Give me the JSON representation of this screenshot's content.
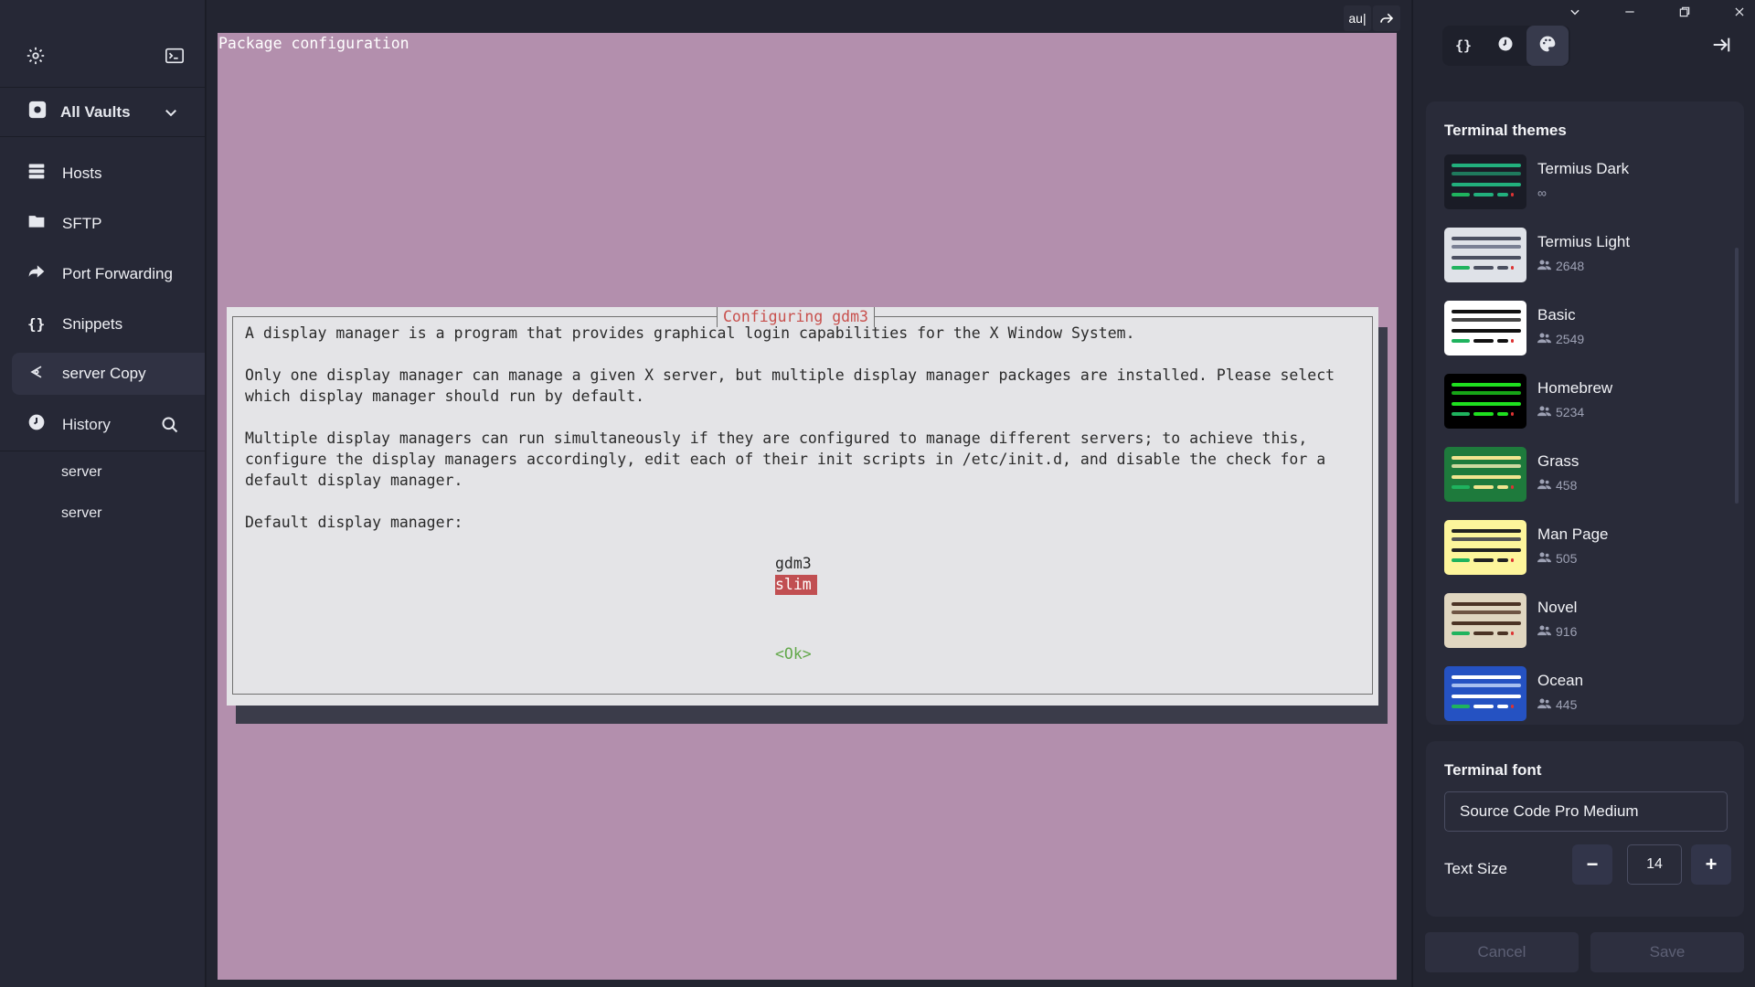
{
  "sidebar": {
    "vault_label": "All Vaults",
    "nav": [
      {
        "label": "Hosts"
      },
      {
        "label": "SFTP"
      },
      {
        "label": "Port Forwarding"
      },
      {
        "label": "Snippets"
      }
    ],
    "active_session": "server Copy",
    "history_label": "History",
    "history_items": [
      "server",
      "server"
    ]
  },
  "terminal": {
    "title": "Package configuration",
    "tool_text": "au|",
    "dialog": {
      "title": "Configuring gdm3",
      "line1": "A display manager is a program that provides graphical login capabilities for the X Window System.",
      "line2": "Only one display manager can manage a given X server, but multiple display manager packages are installed. Please select",
      "line3": "which display manager should run by default.",
      "line4": "Multiple display managers can run simultaneously if they are configured to manage different servers; to achieve this,",
      "line5": "configure the display managers accordingly, edit each of their init scripts in /etc/init.d, and disable the check for a",
      "line6": "default display manager.",
      "line7": "Default display manager:",
      "options": [
        "gdm3",
        "slim"
      ],
      "selected": "slim",
      "ok": "<Ok>"
    }
  },
  "panel": {
    "themes_title": "Terminal themes",
    "themes": [
      {
        "name": "Termius Dark",
        "count": "∞",
        "bg": "#1a1c26",
        "bar": "#22b07d",
        "bar2": "#1f7a5d"
      },
      {
        "name": "Termius Light",
        "count": "2648",
        "bg": "#dfe2e8",
        "bar": "#4a4f60",
        "bar2": "#7a8094"
      },
      {
        "name": "Basic",
        "count": "2549",
        "bg": "#ffffff",
        "bar": "#111111",
        "bar2": "#444444"
      },
      {
        "name": "Homebrew",
        "count": "5234",
        "bg": "#000000",
        "bar": "#1fe01f",
        "bar2": "#17a517"
      },
      {
        "name": "Grass",
        "count": "458",
        "bg": "#1e7a3c",
        "bar": "#f1e58f",
        "bar2": "#cfd9a0"
      },
      {
        "name": "Man Page",
        "count": "505",
        "bg": "#fdf59b",
        "bar": "#222222",
        "bar2": "#555555"
      },
      {
        "name": "Novel",
        "count": "916",
        "bg": "#e0d6c0",
        "bar": "#4b3325",
        "bar2": "#6e5443"
      },
      {
        "name": "Ocean",
        "count": "445",
        "bg": "#2552c2",
        "bar": "#ffffff",
        "bar2": "#a8c0f0"
      }
    ],
    "font_title": "Terminal font",
    "font_value": "Source Code Pro Medium",
    "text_size_label": "Text Size",
    "text_size_value": "14",
    "minus": "−",
    "plus": "+",
    "cancel_label": "Cancel",
    "save_label": "Save"
  }
}
